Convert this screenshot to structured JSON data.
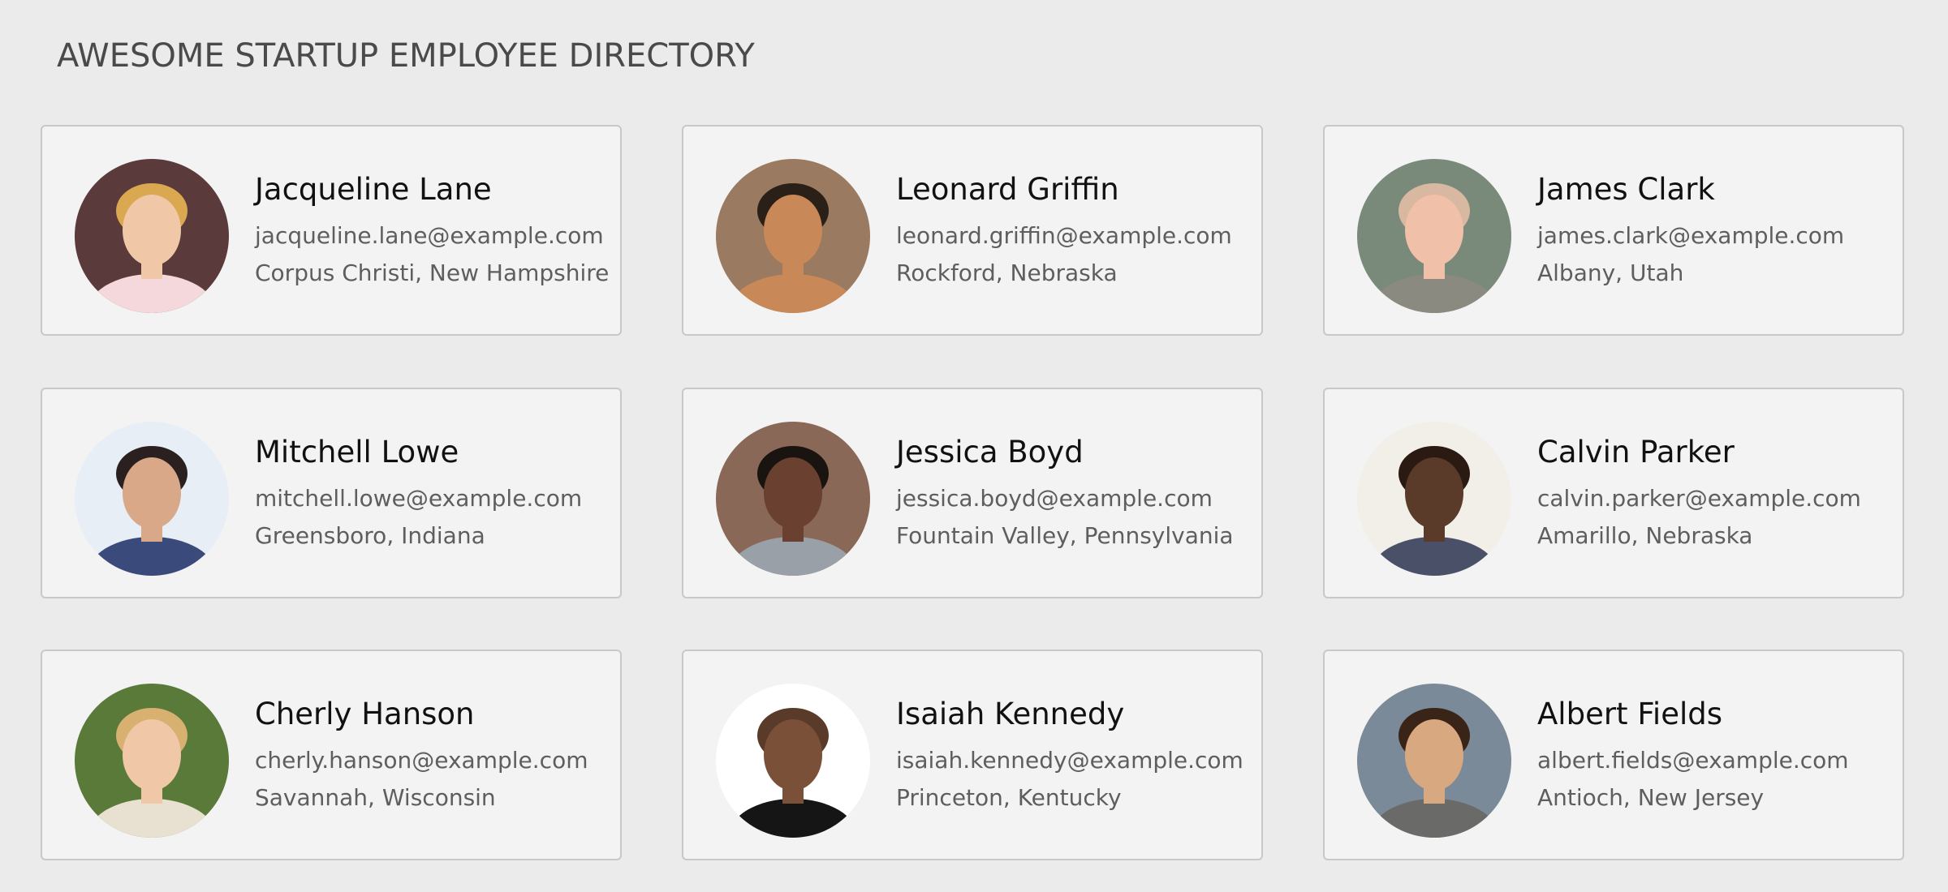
{
  "header": {
    "title": "AWESOME STARTUP EMPLOYEE DIRECTORY"
  },
  "employees": [
    {
      "name": "Jacqueline Lane",
      "email": "jacqueline.lane@example.com",
      "location": "Corpus Christi, New Hampshire",
      "photo": {
        "bg": "#5a3a3a",
        "skin": "#f0c8a8",
        "hair": "#d9a850",
        "shirt": "#f5d8dc"
      }
    },
    {
      "name": "Leonard Griffin",
      "email": "leonard.griffin@example.com",
      "location": "Rockford, Nebraska",
      "photo": {
        "bg": "#9a7a60",
        "skin": "#c88858",
        "hair": "#2a2018",
        "shirt": "#c88858"
      }
    },
    {
      "name": "James Clark",
      "email": "james.clark@example.com",
      "location": "Albany, Utah",
      "photo": {
        "bg": "#7a8a7a",
        "skin": "#f0c0a8",
        "hair": "#d8b8a0",
        "shirt": "#8a8a80"
      }
    },
    {
      "name": "Mitchell Lowe",
      "email": "mitchell.lowe@example.com",
      "location": "Greensboro, Indiana",
      "photo": {
        "bg": "#e8eef5",
        "skin": "#d8a888",
        "hair": "#2a2020",
        "shirt": "#3a4a7a"
      }
    },
    {
      "name": "Jessica Boyd",
      "email": "jessica.boyd@example.com",
      "location": "Fountain Valley, Pennsylvania",
      "photo": {
        "bg": "#8a6858",
        "skin": "#6a4030",
        "hair": "#1a1410",
        "shirt": "#9aa0a8"
      }
    },
    {
      "name": "Calvin Parker",
      "email": "calvin.parker@example.com",
      "location": "Amarillo, Nebraska",
      "photo": {
        "bg": "#f2efe8",
        "skin": "#5a3a28",
        "hair": "#2a1a12",
        "shirt": "#4a5068"
      }
    },
    {
      "name": "Cherly Hanson",
      "email": "cherly.hanson@example.com",
      "location": "Savannah, Wisconsin",
      "photo": {
        "bg": "#5a7a3a",
        "skin": "#f0c8a8",
        "hair": "#d8b070",
        "shirt": "#e8e0d0"
      }
    },
    {
      "name": "Isaiah Kennedy",
      "email": "isaiah.kennedy@example.com",
      "location": "Princeton, Kentucky",
      "photo": {
        "bg": "#ffffff",
        "skin": "#7a5038",
        "hair": "#5a3a28",
        "shirt": "#151515"
      }
    },
    {
      "name": "Albert Fields",
      "email": "albert.fields@example.com",
      "location": "Antioch, New Jersey",
      "photo": {
        "bg": "#7a8a98",
        "skin": "#d8a880",
        "hair": "#3a2418",
        "shirt": "#6a6a68"
      }
    }
  ]
}
